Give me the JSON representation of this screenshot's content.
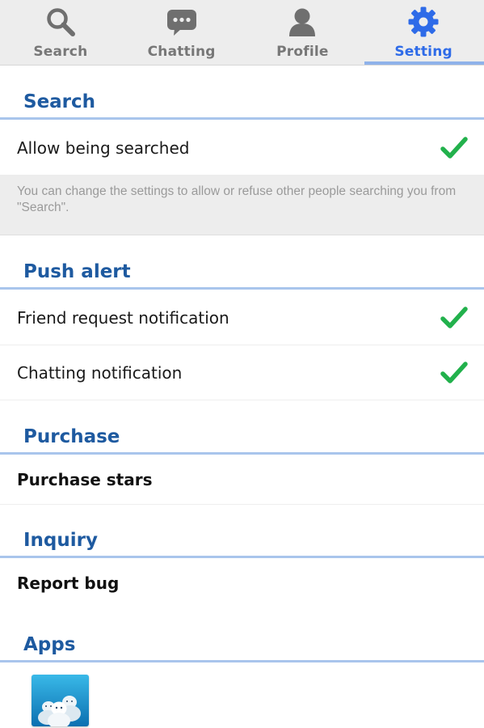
{
  "tabs": [
    {
      "label": "Search",
      "icon": "search-icon",
      "active": false
    },
    {
      "label": "Chatting",
      "icon": "chat-bubble-icon",
      "active": false
    },
    {
      "label": "Profile",
      "icon": "person-icon",
      "active": false
    },
    {
      "label": "Setting",
      "icon": "gear-icon",
      "active": true
    }
  ],
  "colors": {
    "active_tab": "#2e6be8",
    "inactive_tab": "#777777",
    "section_header": "#1e5aa0",
    "divider": "#a9c5ec",
    "check": "#22b14c"
  },
  "sections": {
    "search": {
      "title": "Search",
      "allow_searched": {
        "label": "Allow being searched",
        "checked": true
      },
      "hint": "You can change the settings to allow or refuse other people searching you from \"Search\"."
    },
    "push_alert": {
      "title": "Push alert",
      "friend_request": {
        "label": "Friend request notification",
        "checked": true
      },
      "chatting": {
        "label": "Chatting notification",
        "checked": true
      }
    },
    "purchase": {
      "title": "Purchase",
      "purchase_stars": {
        "label": "Purchase stars"
      }
    },
    "inquiry": {
      "title": "Inquiry",
      "report_bug": {
        "label": "Report bug"
      }
    },
    "apps": {
      "title": "Apps",
      "app_icon": "group-snowmen-app-icon"
    }
  }
}
